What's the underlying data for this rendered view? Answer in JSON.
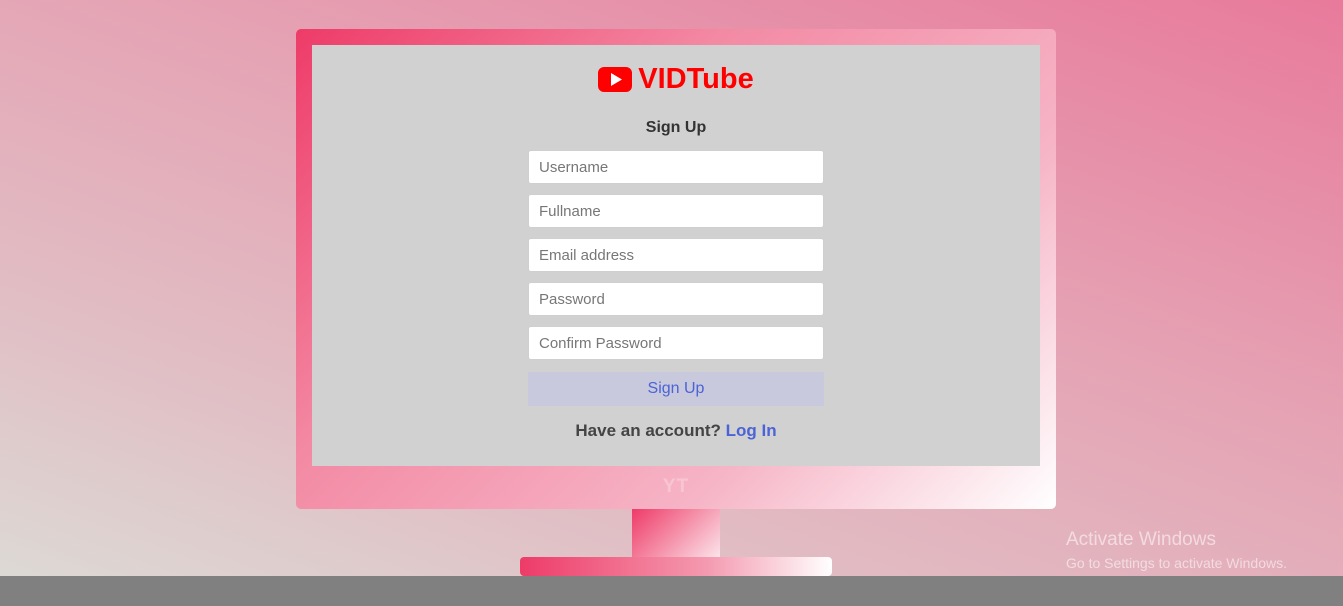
{
  "app": {
    "name": "VIDTube",
    "logo_icon": "youtube-play-icon",
    "brand_color": "#ff0000"
  },
  "form": {
    "title": "Sign Up",
    "fields": {
      "username": {
        "placeholder": "Username",
        "value": ""
      },
      "fullname": {
        "placeholder": "Fullname",
        "value": ""
      },
      "email": {
        "placeholder": "Email address",
        "value": ""
      },
      "password": {
        "placeholder": "Password",
        "value": ""
      },
      "confirm_password": {
        "placeholder": "Confirm Password",
        "value": ""
      }
    },
    "submit_label": "Sign Up",
    "account_prompt": "Have an account?",
    "login_link_label": "Log In",
    "accent_color": "#4b63d6"
  },
  "monitor": {
    "label": "YT"
  },
  "os_watermark": {
    "title": "Activate Windows",
    "subtitle": "Go to Settings to activate Windows."
  }
}
